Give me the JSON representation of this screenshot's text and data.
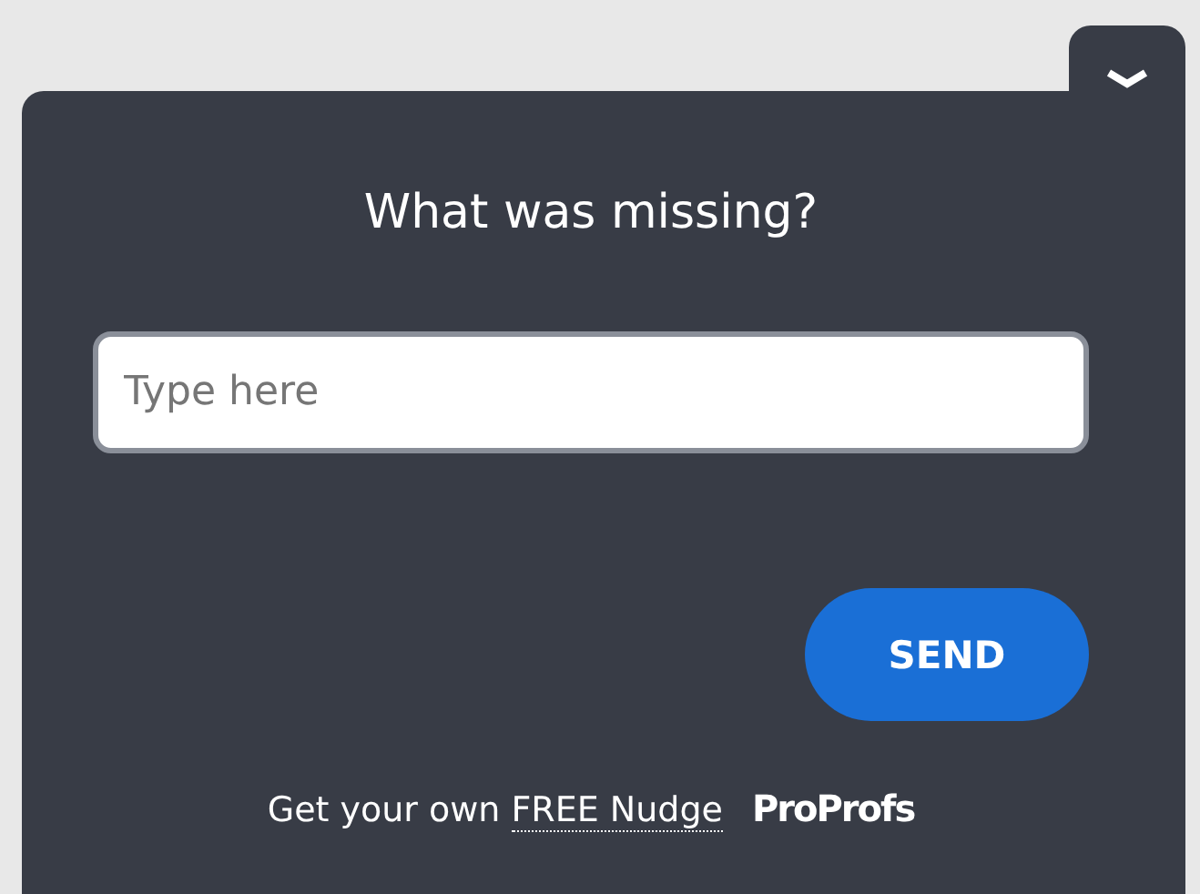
{
  "question": "What was missing?",
  "answer_field": {
    "placeholder": "Type here"
  },
  "send_button": "SEND",
  "footer": {
    "text": "Get your own",
    "link": "FREE Nudge",
    "brand": "ProProfs"
  }
}
